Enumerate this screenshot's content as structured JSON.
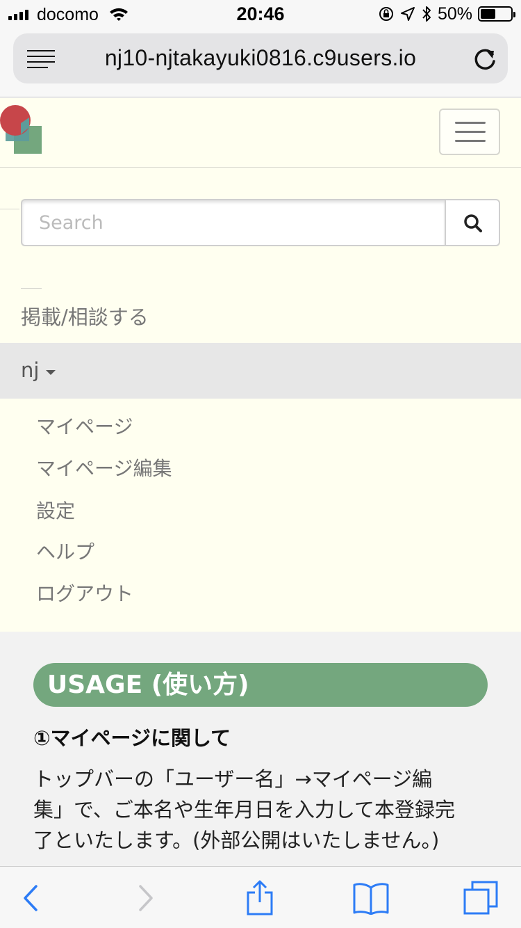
{
  "status_bar": {
    "carrier": "docomo",
    "time": "20:46",
    "battery_text": "50%",
    "battery_level": 0.5,
    "icons": [
      "signal-icon",
      "wifi-icon",
      "orientation-lock-icon",
      "location-icon",
      "bluetooth-icon",
      "battery-icon"
    ]
  },
  "browser": {
    "url": "nj10-njtakayuki0816.c9users.io",
    "icons": [
      "reader-view-icon",
      "reload-icon"
    ]
  },
  "navbar": {
    "search": {
      "placeholder": "Search",
      "value": ""
    },
    "post_link": "掲載/相談する",
    "user": {
      "name": "nj"
    },
    "dropdown_items": [
      "マイページ",
      "マイページ編集",
      "設定",
      "ヘルプ",
      "ログアウト"
    ]
  },
  "content": {
    "heading": "USAGE (使い方)",
    "section_title": "①マイページに関して",
    "section_body_lines": [
      "トップバーの「ユーザー名」→マイページ編",
      "集」で、ご本名や生年月日を入力して本登録完",
      "了といたします。(外部公開はいたしません。)"
    ]
  },
  "toolbar": {
    "icons": [
      "back-icon",
      "forward-icon",
      "share-icon",
      "bookmarks-icon",
      "tabs-icon"
    ]
  },
  "colors": {
    "navbar_bg": "#fffff0",
    "usage_heading_bg": "#74a77e",
    "ios_blue": "#2d7cf6"
  }
}
